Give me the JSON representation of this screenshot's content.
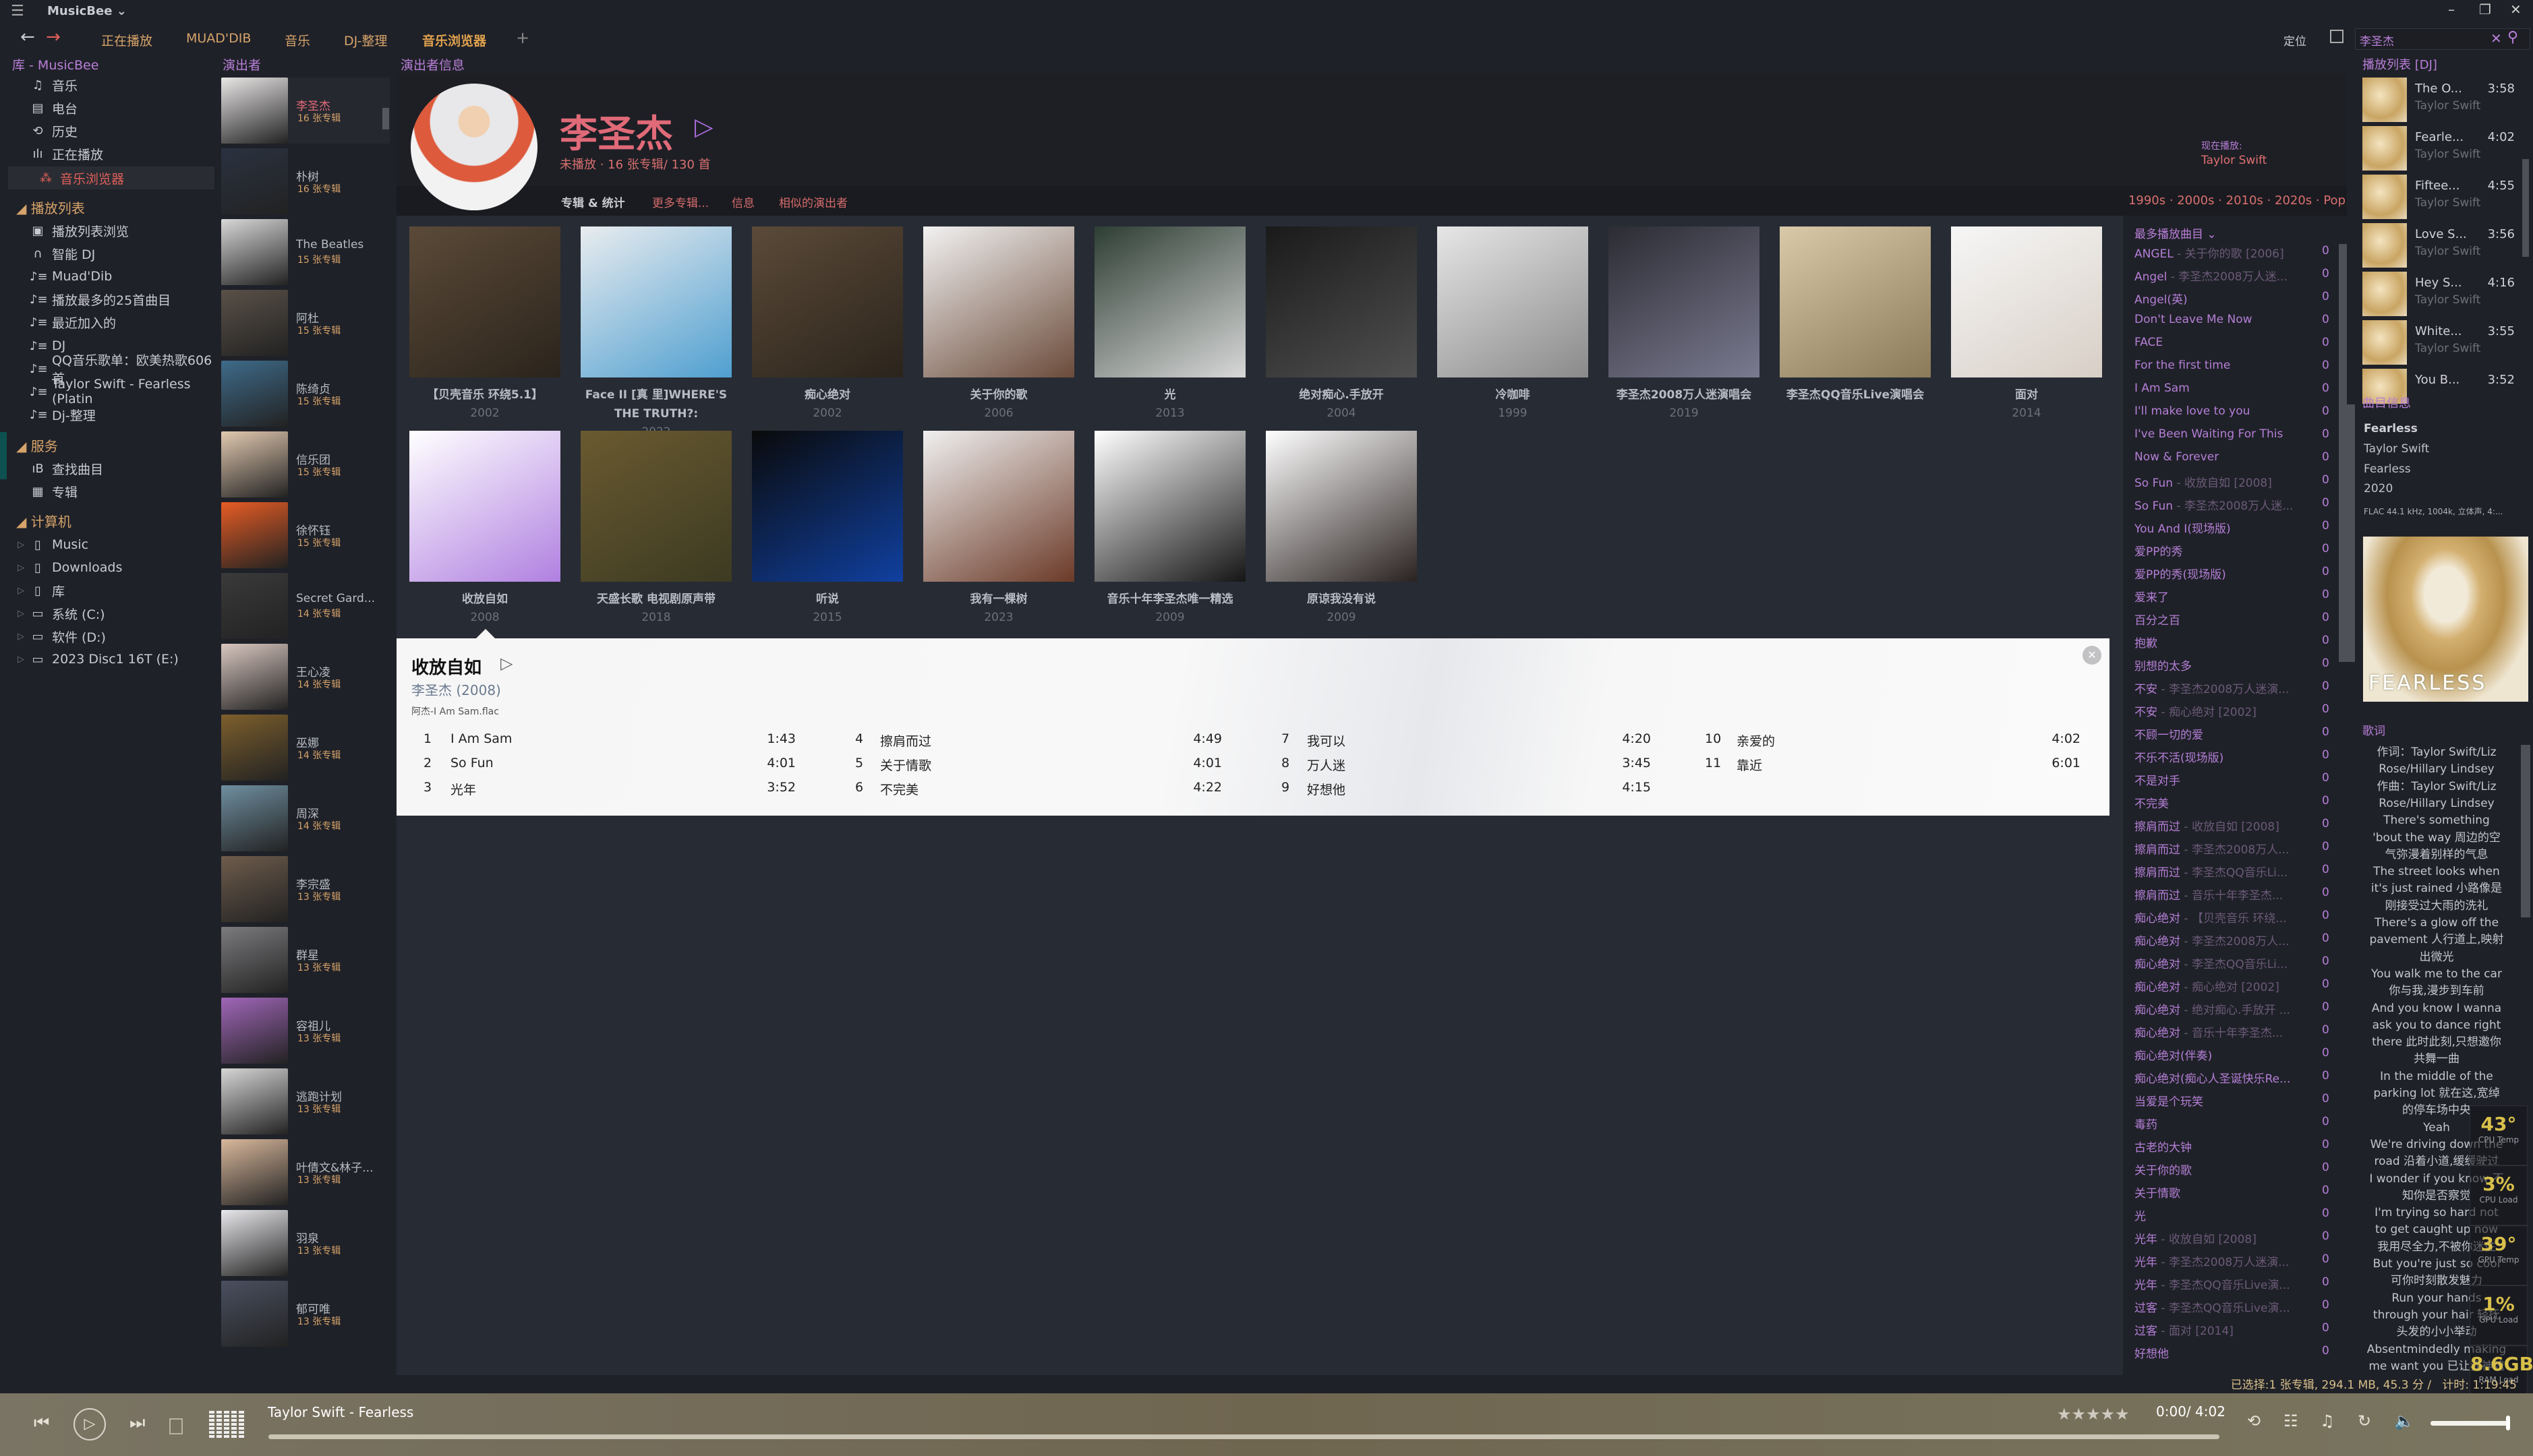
{
  "app": {
    "title": "MusicBee",
    "window_controls": [
      "minimize",
      "maximize",
      "close"
    ]
  },
  "nav": {
    "tabs": [
      "正在播放",
      "MUAD'DIB",
      "音乐",
      "DJ-整理",
      "音乐浏览器"
    ],
    "active_tab": "音乐浏览器",
    "add_tab": "+",
    "locate": "定位"
  },
  "search": {
    "value": "李圣杰"
  },
  "panels": {
    "library": "库 - MusicBee",
    "artists": "演出者",
    "artist_info": "演出者信息"
  },
  "sidebar": {
    "library_items": [
      {
        "icon": "music-note-icon",
        "label": "音乐"
      },
      {
        "icon": "radio-icon",
        "label": "电台"
      },
      {
        "icon": "history-icon",
        "label": "历史"
      },
      {
        "icon": "waveform-icon",
        "label": "正在播放"
      },
      {
        "icon": "browser-icon",
        "label": "音乐浏览器",
        "active": true
      }
    ],
    "playlists_header": "播放列表",
    "playlists": [
      {
        "icon": "playlist-browse-icon",
        "label": "播放列表浏览"
      },
      {
        "icon": "headphones-icon",
        "label": "智能 DJ"
      },
      {
        "icon": "playlist-icon",
        "label": "Muad'Dib"
      },
      {
        "icon": "playlist-icon",
        "label": "播放最多的25首曲目"
      },
      {
        "icon": "playlist-icon",
        "label": "最近加入的"
      },
      {
        "icon": "playlist-icon",
        "label": "DJ"
      },
      {
        "icon": "playlist-icon",
        "label": "QQ音乐歌单：欧美热歌606首"
      },
      {
        "icon": "playlist-icon",
        "label": "Taylor Swift - Fearless (Platin"
      },
      {
        "icon": "playlist-icon",
        "label": "Dj-整理"
      }
    ],
    "services_header": "服务",
    "services": [
      {
        "icon": "find-tracks-icon",
        "label": "查找曲目"
      },
      {
        "icon": "album-grid-icon",
        "label": "专辑"
      }
    ],
    "computer_header": "计算机",
    "computer": [
      {
        "icon": "folder-icon",
        "label": "Music"
      },
      {
        "icon": "folder-icon",
        "label": "Downloads"
      },
      {
        "icon": "folder-icon",
        "label": "库"
      },
      {
        "icon": "drive-icon",
        "label": "系统 (C:)"
      },
      {
        "icon": "drive-icon",
        "label": "软件 (D:)"
      },
      {
        "icon": "drive-icon",
        "label": "2023 Disc1 16T (E:)"
      }
    ]
  },
  "artists": [
    {
      "name": "李圣杰",
      "count": "16 张专辑",
      "color": "#e9e6e6",
      "selected": true
    },
    {
      "name": "朴树",
      "count": "16 张专辑",
      "color": "#2a3240"
    },
    {
      "name": "The Beatles",
      "count": "15 张专辑",
      "color": "#d8d8d8"
    },
    {
      "name": "阿杜",
      "count": "15 张专辑",
      "color": "#5a5148"
    },
    {
      "name": "陈绮贞",
      "count": "15 张专辑",
      "color": "#3e6b8a"
    },
    {
      "name": "信乐团",
      "count": "15 张专辑",
      "color": "#e2c9b0"
    },
    {
      "name": "徐怀钰",
      "count": "15 张专辑",
      "color": "#e65c24"
    },
    {
      "name": "Secret Gard...",
      "count": "14 张专辑",
      "color": "#3a3a3a"
    },
    {
      "name": "王心凌",
      "count": "14 张专辑",
      "color": "#d9c7c0"
    },
    {
      "name": "巫娜",
      "count": "14 张专辑",
      "color": "#7d5f2c"
    },
    {
      "name": "周深",
      "count": "14 张专辑",
      "color": "#6f8fa0"
    },
    {
      "name": "李宗盛",
      "count": "13 张专辑",
      "color": "#6e5c4c"
    },
    {
      "name": "群星",
      "count": "13 张专辑",
      "color": "#7b7b7e"
    },
    {
      "name": "容祖儿",
      "count": "13 张专辑",
      "color": "#a066b8"
    },
    {
      "name": "逃跑计划",
      "count": "13 张专辑",
      "color": "#d6d6d6"
    },
    {
      "name": "叶倩文&林子...",
      "count": "13 张专辑",
      "color": "#d9b89c"
    },
    {
      "name": "羽泉",
      "count": "13 张专辑",
      "color": "#e8e8ec"
    },
    {
      "name": "郁可唯",
      "count": "13 张专辑",
      "color": "#4a5060"
    }
  ],
  "artist_header": {
    "name": "李圣杰",
    "stats": "未播放 · 16 张专辑/ 130 首",
    "tabs": [
      "专辑 & 统计",
      "更多专辑...",
      "信息",
      "相似的演出者"
    ],
    "now_playing_label": "现在播放:",
    "now_playing_artist": "Taylor Swift",
    "genres": "1990s · 2000s · 2010s · 2020s · Pop",
    "accent": "#e06a78"
  },
  "albums": [
    {
      "title": "【贝壳音乐 环绕5.1】",
      "year": "2002",
      "c1": "#5b4a38",
      "c2": "#2b241c"
    },
    {
      "title": "Face II [真 里]WHERE'S THE TRUTH?:",
      "year": "2022",
      "c1": "#e9ecef",
      "c2": "#4f9fd0"
    },
    {
      "title": "痴心绝对",
      "year": "2002",
      "c1": "#5b4a38",
      "c2": "#2b241c"
    },
    {
      "title": "关于你的歌",
      "year": "2006",
      "c1": "#f2f2f2",
      "c2": "#6b4b3a"
    },
    {
      "title": "光",
      "year": "2013",
      "c1": "#2e3e34",
      "c2": "#d8d8d8"
    },
    {
      "title": "绝对痴心.手放开",
      "year": "2004",
      "c1": "#1a1a1a",
      "c2": "#505050"
    },
    {
      "title": "冷咖啡",
      "year": "1999",
      "c1": "#e6e6e6",
      "c2": "#8a8a8a"
    },
    {
      "title": "李圣杰2008万人迷演唱会",
      "year": "2019",
      "c1": "#2c2c34",
      "c2": "#7a7a90"
    },
    {
      "title": "李圣杰QQ音乐Live演唱会",
      "year": "",
      "c1": "#d9c9a8",
      "c2": "#8a7a5a"
    },
    {
      "title": "面对",
      "year": "2014",
      "c1": "#f6f6f6",
      "c2": "#d8cfc6"
    },
    {
      "title": "收放自如",
      "year": "2008",
      "c1": "#ffffff",
      "c2": "#b080e0"
    },
    {
      "title": "天盛长歌 电视剧原声带",
      "year": "2018",
      "c1": "#6a5a30",
      "c2": "#3c3a22"
    },
    {
      "title": "听说",
      "year": "2015",
      "c1": "#0a0a0a",
      "c2": "#1040a0"
    },
    {
      "title": "我有一棵树",
      "year": "2023",
      "c1": "#f0f0f0",
      "c2": "#6b3a28"
    },
    {
      "title": "音乐十年李圣杰唯一精选",
      "year": "2009",
      "c1": "#ffffff",
      "c2": "#151515"
    },
    {
      "title": "原谅我没有说",
      "year": "2009",
      "c1": "#ffffff",
      "c2": "#2a2220"
    }
  ],
  "album_detail": {
    "title": "收放自如",
    "subtitle": "李圣杰 (2008)",
    "file": "阿杰-I Am Sam.flac",
    "tracks": [
      {
        "n": "1",
        "t": "I Am Sam",
        "d": "1:43"
      },
      {
        "n": "2",
        "t": "So Fun",
        "d": "4:01"
      },
      {
        "n": "3",
        "t": "光年",
        "d": "3:52"
      },
      {
        "n": "4",
        "t": "擦肩而过",
        "d": "4:49"
      },
      {
        "n": "5",
        "t": "关于情歌",
        "d": "4:01"
      },
      {
        "n": "6",
        "t": "不完美",
        "d": "4:22"
      },
      {
        "n": "7",
        "t": "我可以",
        "d": "4:20"
      },
      {
        "n": "8",
        "t": "万人迷",
        "d": "3:45"
      },
      {
        "n": "9",
        "t": "好想他",
        "d": "4:15"
      },
      {
        "n": "10",
        "t": "亲爱的",
        "d": "4:02"
      },
      {
        "n": "11",
        "t": "靠近",
        "d": "6:01"
      }
    ]
  },
  "top_tracks": {
    "header": "最多播放曲目",
    "items": [
      {
        "t": "ANGEL",
        "a": " - 关于你的歌 [2006]",
        "p": "0"
      },
      {
        "t": "Angel",
        "a": " - 李圣杰2008万人迷...",
        "p": "0"
      },
      {
        "t": "Angel(英)",
        "a": "",
        "p": "0"
      },
      {
        "t": "Don't Leave Me Now",
        "a": "",
        "p": "0"
      },
      {
        "t": "FACE",
        "a": "",
        "p": "0"
      },
      {
        "t": "For the first time",
        "a": "",
        "p": "0"
      },
      {
        "t": "I Am Sam",
        "a": "",
        "p": "0"
      },
      {
        "t": "I'll make love to you",
        "a": "",
        "p": "0"
      },
      {
        "t": "I've Been Waiting For This",
        "a": "",
        "p": "0"
      },
      {
        "t": "Now & Forever",
        "a": "",
        "p": "0"
      },
      {
        "t": "So Fun",
        "a": " - 收放自如 [2008]",
        "p": "0"
      },
      {
        "t": "So Fun",
        "a": " - 李圣杰2008万人迷...",
        "p": "0"
      },
      {
        "t": "You And I(现场版)",
        "a": "",
        "p": "0"
      },
      {
        "t": "爱PP的秀",
        "a": "",
        "p": "0"
      },
      {
        "t": "爱PP的秀(现场版)",
        "a": "",
        "p": "0"
      },
      {
        "t": "爱来了",
        "a": "",
        "p": "0"
      },
      {
        "t": "百分之百",
        "a": "",
        "p": "0"
      },
      {
        "t": "抱歉",
        "a": "",
        "p": "0"
      },
      {
        "t": "别想的太多",
        "a": "",
        "p": "0"
      },
      {
        "t": "不安",
        "a": " - 李圣杰2008万人迷演...",
        "p": "0"
      },
      {
        "t": "不安",
        "a": " - 痴心绝对 [2002]",
        "p": "0"
      },
      {
        "t": "不顾一切的爱",
        "a": "",
        "p": "0"
      },
      {
        "t": "不乐不活(现场版)",
        "a": "",
        "p": "0"
      },
      {
        "t": "不是对手",
        "a": "",
        "p": "0"
      },
      {
        "t": "不完美",
        "a": "",
        "p": "0"
      },
      {
        "t": "擦肩而过",
        "a": " - 收放自如 [2008]",
        "p": "0"
      },
      {
        "t": "擦肩而过",
        "a": " - 李圣杰2008万人...",
        "p": "0"
      },
      {
        "t": "擦肩而过",
        "a": " - 李圣杰QQ音乐Li...",
        "p": "0"
      },
      {
        "t": "擦肩而过",
        "a": " - 音乐十年李圣杰...",
        "p": "0"
      },
      {
        "t": "痴心绝对",
        "a": " - 【贝壳音乐 环绕...",
        "p": "0"
      },
      {
        "t": "痴心绝对",
        "a": " - 李圣杰2008万人...",
        "p": "0"
      },
      {
        "t": "痴心绝对",
        "a": " - 李圣杰QQ音乐Li...",
        "p": "0"
      },
      {
        "t": "痴心绝对",
        "a": " - 痴心绝对 [2002]",
        "p": "0"
      },
      {
        "t": "痴心绝对",
        "a": " - 绝对痴心.手放开 ...",
        "p": "0"
      },
      {
        "t": "痴心绝对",
        "a": " - 音乐十年李圣杰...",
        "p": "0"
      },
      {
        "t": "痴心绝对(伴奏)",
        "a": "",
        "p": "0"
      },
      {
        "t": "痴心绝对(痴心人圣诞快乐Re...",
        "a": "",
        "p": "0"
      },
      {
        "t": "当爱是个玩笑",
        "a": "",
        "p": "0"
      },
      {
        "t": "毒药",
        "a": "",
        "p": "0"
      },
      {
        "t": "古老的大钟",
        "a": "",
        "p": "0"
      },
      {
        "t": "关于你的歌",
        "a": "",
        "p": "0"
      },
      {
        "t": "关于情歌",
        "a": "",
        "p": "0"
      },
      {
        "t": "光",
        "a": "",
        "p": "0"
      },
      {
        "t": "光年",
        "a": " - 收放自如 [2008]",
        "p": "0"
      },
      {
        "t": "光年",
        "a": " - 李圣杰2008万人迷演...",
        "p": "0"
      },
      {
        "t": "光年",
        "a": " - 李圣杰QQ音乐Live演...",
        "p": "0"
      },
      {
        "t": "过客",
        "a": " - 李圣杰QQ音乐Live演...",
        "p": "0"
      },
      {
        "t": "过客",
        "a": " - 面对 [2014]",
        "p": "0"
      },
      {
        "t": "好想他",
        "a": "",
        "p": "0"
      }
    ]
  },
  "playlist": {
    "header": "播放列表  [DJ]",
    "items": [
      {
        "t": "The O...",
        "a": "Taylor Swift",
        "d": "3:58"
      },
      {
        "t": "Fearle...",
        "a": "Taylor Swift",
        "d": "4:02"
      },
      {
        "t": "Fiftee...",
        "a": "Taylor Swift",
        "d": "4:55"
      },
      {
        "t": "Love S...",
        "a": "Taylor Swift",
        "d": "3:56"
      },
      {
        "t": "Hey S...",
        "a": "Taylor Swift",
        "d": "4:16"
      },
      {
        "t": "White...",
        "a": "Taylor Swift",
        "d": "3:55"
      },
      {
        "t": "You B...",
        "a": "",
        "d": "3:52"
      }
    ]
  },
  "track_info": {
    "header": "曲目信息",
    "title": "Fearless",
    "artist": "Taylor Swift",
    "album": "Fearless",
    "year": "2020",
    "format": "FLAC 44.1 kHz, 1004k, 立体声, 4:...",
    "cover_text": "Taylor Swift FEARLESS"
  },
  "lyrics": {
    "header": "歌词",
    "lines": [
      "作词：Taylor Swift/Liz",
      "Rose/Hillary Lindsey",
      "作曲：Taylor Swift/Liz",
      "Rose/Hillary Lindsey",
      "There's something",
      "'bout the way 周边的空",
      "气弥漫着别样的气息",
      "The street looks when",
      "it's just rained 小路像是",
      "刚接受过大雨的洗礼",
      "There's a glow off the",
      "pavement 人行道上,映射",
      "出微光",
      "You walk me to the car",
      "你与我,漫步到车前",
      "And you know I wanna",
      "ask you to dance right",
      "there 此时此刻,只想邀你",
      "共舞一曲",
      "In the middle of the",
      "parking lot 就在这,宽绰",
      "的停车场中央",
      "Yeah",
      "We're driving down the",
      "road 沿着小道,缓缓驶过",
      "I wonder if you know 不",
      "知你是否察觉",
      "I'm trying so hard not",
      "to get caught up now",
      "我用尽全力,不被你迷住",
      "But you're just so cool",
      "可你时刻散发魅力",
      "Run your hands",
      "through your hair 轻抚",
      "头发的小小举动",
      "Absentmindedly making",
      "me want you 已让我神魂"
    ]
  },
  "monitor": [
    {
      "v": "43°",
      "l": "CPU Temp"
    },
    {
      "v": "3%",
      "l": "CPU Load"
    },
    {
      "v": "39°",
      "l": "GPU Temp"
    },
    {
      "v": "1%",
      "l": "GPU Load"
    },
    {
      "v": "8.6GB",
      "l": "RAM Load"
    }
  ],
  "status": {
    "text": "已选择:1 张专辑, 294.1 MB, 45.3 分 /   计时: 1:19:45"
  },
  "player": {
    "now_playing": "Taylor Swift - Fearless",
    "time": "0:00/ 4:02",
    "rating_stars": 5,
    "progress": 0,
    "volume": 1.0
  }
}
